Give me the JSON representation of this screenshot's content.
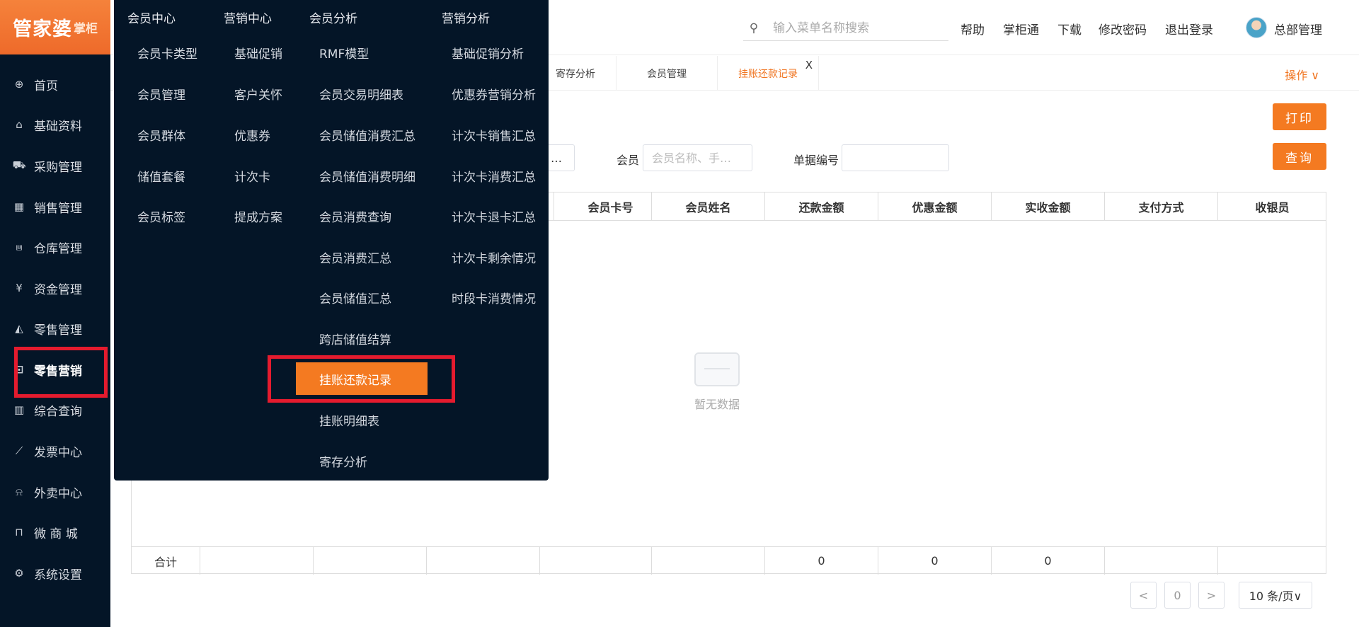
{
  "brand": {
    "name": "管家婆",
    "sub": "掌柜"
  },
  "sidebar": {
    "items": [
      {
        "label": "首页",
        "icon": "globe-icon"
      },
      {
        "label": "基础资料",
        "icon": "home-icon"
      },
      {
        "label": "采购管理",
        "icon": "cart-icon"
      },
      {
        "label": "销售管理",
        "icon": "calendar-icon"
      },
      {
        "label": "仓库管理",
        "icon": "bank-icon"
      },
      {
        "label": "资金管理",
        "icon": "money-icon"
      },
      {
        "label": "零售管理",
        "icon": "chart-area-icon"
      },
      {
        "label": "零售营销",
        "icon": "gift-icon"
      },
      {
        "label": "综合查询",
        "icon": "bar-chart-icon"
      },
      {
        "label": "发票中心",
        "icon": "line-chart-icon"
      },
      {
        "label": "外卖中心",
        "icon": "alarm-icon"
      },
      {
        "label": "微 商 城",
        "icon": "bag-icon"
      },
      {
        "label": "系统设置",
        "icon": "gear-icon"
      }
    ]
  },
  "header": {
    "search_placeholder": "输入菜单名称搜索",
    "links": [
      "帮助",
      "掌柜通",
      "下载",
      "修改密码",
      "退出登录"
    ],
    "user": "总部管理"
  },
  "tabs": [
    {
      "label": "寄存分析"
    },
    {
      "label": "会员管理"
    },
    {
      "label": "挂账还款记录",
      "close": "X"
    }
  ],
  "ops_label": "操作 ∨",
  "print_label": "打印",
  "query_label": "查询",
  "filters": {
    "ellipsis": "…",
    "member_label": "会员",
    "member_placeholder": "会员名称、手…",
    "bill_label": "单据编号"
  },
  "table": {
    "headers": [
      "会员卡号",
      "会员姓名",
      "还款金额",
      "优惠金额",
      "实收金额",
      "支付方式",
      "收银员"
    ],
    "empty_text": "暂无数据",
    "footer_label": "合计",
    "footer_values": [
      "0",
      "0",
      "0"
    ]
  },
  "pagination": {
    "prev": "<",
    "page": "0",
    "next": ">",
    "size": "10 条/页∨"
  },
  "mega_menu": {
    "headers": [
      "会员中心",
      "营销中心",
      "会员分析",
      "营销分析"
    ],
    "col1": [
      "会员卡类型",
      "会员管理",
      "会员群体",
      "储值套餐",
      "会员标签"
    ],
    "col2": [
      "基础促销",
      "客户关怀",
      "优惠券",
      "计次卡",
      "提成方案"
    ],
    "col3": [
      "RMF模型",
      "会员交易明细表",
      "会员储值消费汇总",
      "会员储值消费明细",
      "会员消费查询",
      "会员消费汇总",
      "会员储值汇总",
      "跨店储值结算",
      "挂账还款记录",
      "挂账明细表",
      "寄存分析"
    ],
    "col4": [
      "基础促销分析",
      "优惠券营销分析",
      "计次卡销售汇总",
      "计次卡消费汇总",
      "计次卡退卡汇总",
      "计次卡剩余情况",
      "时段卡消费情况"
    ]
  },
  "colors": {
    "accent": "#f47a21",
    "sidebar_bg": "#041527",
    "highlight_border": "#e51b2e"
  }
}
